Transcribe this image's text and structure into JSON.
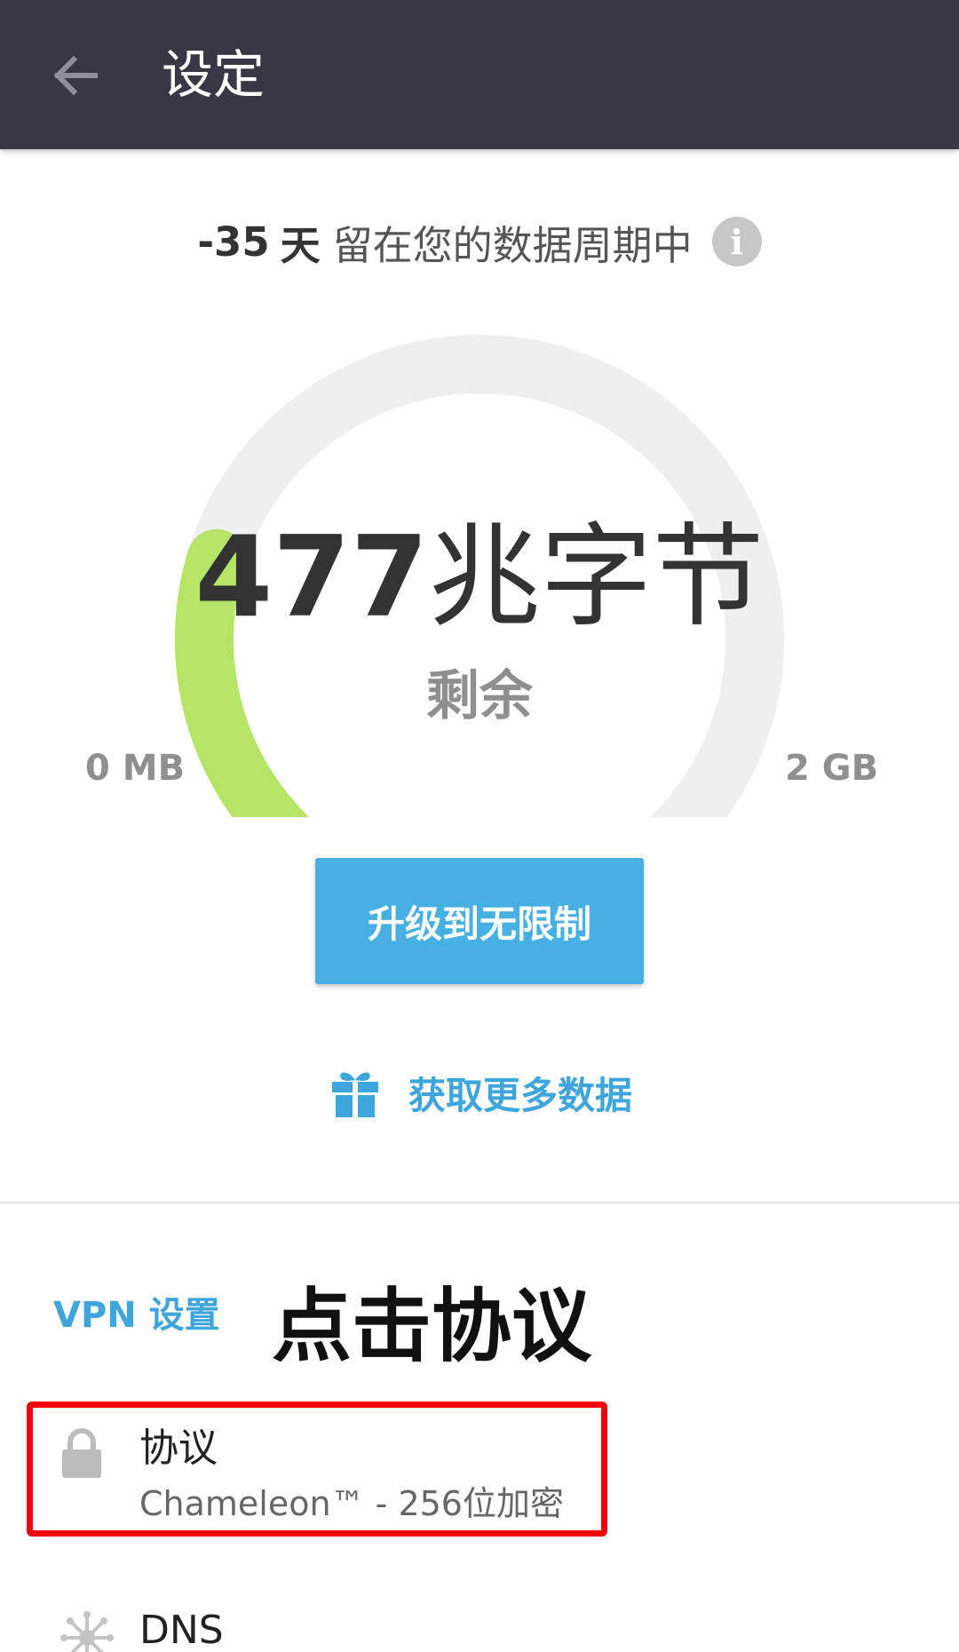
{
  "appbar": {
    "title": "设定",
    "back_icon": "arrow-left-icon"
  },
  "cycle": {
    "days": "-35",
    "days_unit": "天",
    "text": "留在您的数据周期中",
    "info_icon": "info-icon"
  },
  "gauge": {
    "value_number": "477",
    "value_unit": "兆字节",
    "remaining_label": "剩余",
    "min_label": "0 MB",
    "max_label": "2 GB",
    "fill_fraction": 0.23,
    "track_color": "#efefef",
    "fill_color": "#b5e466"
  },
  "actions": {
    "upgrade_label": "升级到无限制",
    "more_data_label": "获取更多数据",
    "gift_icon": "gift-icon"
  },
  "vpn_settings": {
    "section_label": "VPN 设置",
    "annotation": "点击协议",
    "items": [
      {
        "icon": "lock-icon",
        "title": "协议",
        "subtitle": "Chameleon™ - 256位加密"
      },
      {
        "icon": "dns-network-icon",
        "title": "DNS",
        "subtitle": ""
      }
    ]
  },
  "colors": {
    "appbar": "#363943",
    "accent": "#47b0e3",
    "highlight": "#f4000a"
  }
}
